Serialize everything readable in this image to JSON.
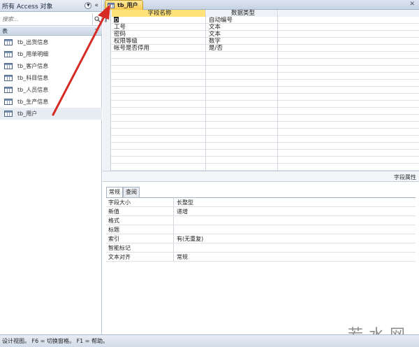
{
  "nav": {
    "title": "所有 Access 对象",
    "search_placeholder": "搜索...",
    "group_label": "表",
    "items": [
      {
        "label": "tb_出货信息"
      },
      {
        "label": "tb_用单明细"
      },
      {
        "label": "tb_客户信息"
      },
      {
        "label": "tb_科目信息"
      },
      {
        "label": "tb_人员信息"
      },
      {
        "label": "tb_生产信息"
      },
      {
        "label": "tb_用户"
      }
    ]
  },
  "tab": {
    "label": "tb_用户"
  },
  "grid": {
    "header_name": "字段名称",
    "header_type": "数据类型",
    "rows": [
      {
        "name": "ID",
        "type": "自动编号"
      },
      {
        "name": "工号",
        "type": "文本"
      },
      {
        "name": "密码",
        "type": "文本"
      },
      {
        "name": "权限等级",
        "type": "数字"
      },
      {
        "name": "帐号是否停用",
        "type": "是/否"
      }
    ]
  },
  "props": {
    "section_label": "字段属性",
    "tabs": [
      "常规",
      "查阅"
    ],
    "rows": [
      {
        "name": "字段大小",
        "value": "长整型"
      },
      {
        "name": "新值",
        "value": "递增"
      },
      {
        "name": "格式",
        "value": ""
      },
      {
        "name": "标题",
        "value": ""
      },
      {
        "name": "索引",
        "value": "有(无重复)"
      },
      {
        "name": "智能标记",
        "value": ""
      },
      {
        "name": "文本对齐",
        "value": "常规"
      }
    ]
  },
  "status": {
    "text": "设计视图。 F6 = 切换窗格。 F1 = 帮助。"
  },
  "watermark": "若水网",
  "colors": {
    "accent_tab": "#f9cb53",
    "annotation_arrow": "#d62b25"
  },
  "icons": {
    "table": "table-icon",
    "search": "search-icon",
    "menu": "chevron-down-icon",
    "collapse": "double-chevron-left-icon"
  }
}
